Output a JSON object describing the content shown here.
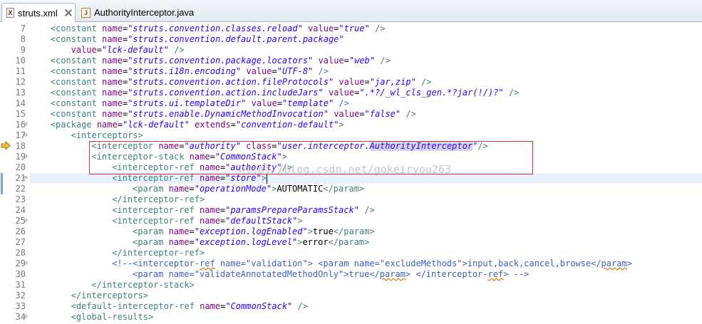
{
  "tabs": [
    {
      "label": "struts.xml",
      "icon": "xml-file-icon",
      "active": true
    },
    {
      "label": "AuthorityInterceptor.java",
      "icon": "java-file-icon",
      "active": false
    }
  ],
  "watermark": "http://blog.csdn.net/gokeiryou263",
  "lines": [
    {
      "num": "7",
      "fold": "",
      "indent": 4,
      "tokens": [
        [
          "t",
          "<constant "
        ],
        [
          "a",
          "name"
        ],
        [
          "tx",
          "="
        ],
        [
          "v",
          "\"struts.convention.classes.reload\""
        ],
        [
          "tx",
          " "
        ],
        [
          "a",
          "value"
        ],
        [
          "tx",
          "="
        ],
        [
          "v",
          "\"true\""
        ],
        [
          "t",
          " />"
        ]
      ]
    },
    {
      "num": "8",
      "fold": "",
      "indent": 4,
      "tokens": [
        [
          "t",
          "<constant "
        ],
        [
          "a",
          "name"
        ],
        [
          "tx",
          "="
        ],
        [
          "v",
          "\"struts.convention.default.parent.package\""
        ]
      ]
    },
    {
      "num": "9",
      "fold": "",
      "indent": 8,
      "tokens": [
        [
          "a",
          "value"
        ],
        [
          "tx",
          "="
        ],
        [
          "v",
          "\"lck-default\""
        ],
        [
          "t",
          " />"
        ]
      ]
    },
    {
      "num": "10",
      "fold": "",
      "indent": 4,
      "tokens": [
        [
          "t",
          "<constant "
        ],
        [
          "a",
          "name"
        ],
        [
          "tx",
          "="
        ],
        [
          "v",
          "\"struts.convention.package.locators\""
        ],
        [
          "tx",
          " "
        ],
        [
          "a",
          "value"
        ],
        [
          "tx",
          "="
        ],
        [
          "v",
          "\"web\""
        ],
        [
          "t",
          " />"
        ]
      ]
    },
    {
      "num": "11",
      "fold": "",
      "indent": 4,
      "tokens": [
        [
          "t",
          "<constant "
        ],
        [
          "a",
          "name"
        ],
        [
          "tx",
          "="
        ],
        [
          "v",
          "\"struts.i18n.encoding\""
        ],
        [
          "tx",
          " "
        ],
        [
          "a",
          "value"
        ],
        [
          "tx",
          "="
        ],
        [
          "v",
          "\"UTF-8\""
        ],
        [
          "t",
          " />"
        ]
      ]
    },
    {
      "num": "12",
      "fold": "",
      "indent": 4,
      "tokens": [
        [
          "t",
          "<constant "
        ],
        [
          "a",
          "name"
        ],
        [
          "tx",
          "="
        ],
        [
          "v",
          "\"struts.convention.action.fileProtocols\""
        ],
        [
          "tx",
          " "
        ],
        [
          "a",
          "value"
        ],
        [
          "tx",
          "="
        ],
        [
          "v",
          "\"jar,zip\""
        ],
        [
          "t",
          " />"
        ]
      ]
    },
    {
      "num": "13",
      "fold": "",
      "indent": 4,
      "tokens": [
        [
          "t",
          "<constant "
        ],
        [
          "a",
          "name"
        ],
        [
          "tx",
          "="
        ],
        [
          "v",
          "\"struts.convention.action.includeJars\""
        ],
        [
          "tx",
          " "
        ],
        [
          "a",
          "value"
        ],
        [
          "tx",
          "="
        ],
        [
          "v",
          "\".*?/_wl_cls_gen.*?jar(!/)?\""
        ],
        [
          "t",
          " />"
        ]
      ]
    },
    {
      "num": "14",
      "fold": "",
      "indent": 4,
      "tokens": [
        [
          "t",
          "<constant "
        ],
        [
          "a",
          "name"
        ],
        [
          "tx",
          "="
        ],
        [
          "v",
          "\"struts.ui.templateDir\""
        ],
        [
          "tx",
          " "
        ],
        [
          "a",
          "value"
        ],
        [
          "tx",
          "="
        ],
        [
          "v",
          "\"template\""
        ],
        [
          "t",
          " />"
        ]
      ]
    },
    {
      "num": "15",
      "fold": "",
      "indent": 4,
      "tokens": [
        [
          "t",
          "<constant "
        ],
        [
          "a",
          "name"
        ],
        [
          "tx",
          "="
        ],
        [
          "v",
          "\"struts.enable.DynamicMethodInvocation\""
        ],
        [
          "tx",
          " "
        ],
        [
          "a",
          "value"
        ],
        [
          "tx",
          "="
        ],
        [
          "v",
          "\"false\""
        ],
        [
          "t",
          " />"
        ]
      ]
    },
    {
      "num": "16",
      "fold": "⊖",
      "indent": 4,
      "tokens": [
        [
          "t",
          "<package "
        ],
        [
          "a",
          "name"
        ],
        [
          "tx",
          "="
        ],
        [
          "v",
          "\"lck-default\""
        ],
        [
          "tx",
          " "
        ],
        [
          "a",
          "extends"
        ],
        [
          "tx",
          "="
        ],
        [
          "v",
          "\"convention-default\""
        ],
        [
          "t",
          ">"
        ]
      ]
    },
    {
      "num": "17",
      "fold": "⊖",
      "indent": 8,
      "tokens": [
        [
          "t",
          "<interceptors>"
        ]
      ]
    },
    {
      "num": "18",
      "fold": "",
      "indent": 12,
      "marker": "arrow",
      "tokens": [
        [
          "t",
          "<interceptor "
        ],
        [
          "a",
          "name"
        ],
        [
          "tx",
          "="
        ],
        [
          "v",
          "\"authority\""
        ],
        [
          "tx",
          " "
        ],
        [
          "a",
          "class"
        ],
        [
          "tx",
          "="
        ],
        [
          "v",
          "\"user.interceptor."
        ],
        [
          "vh",
          "AuthorityInterceptor"
        ],
        [
          "v",
          "\""
        ],
        [
          "t",
          "/>"
        ]
      ]
    },
    {
      "num": "19",
      "fold": "⊖",
      "indent": 12,
      "tokens": [
        [
          "t",
          "<interceptor-stack "
        ],
        [
          "a",
          "name"
        ],
        [
          "tx",
          "="
        ],
        [
          "v",
          "\"CommonStack\""
        ],
        [
          "t",
          ">"
        ]
      ]
    },
    {
      "num": "20",
      "fold": "",
      "indent": 16,
      "tokens": [
        [
          "t",
          "<interceptor-ref "
        ],
        [
          "a",
          "name"
        ],
        [
          "tx",
          "="
        ],
        [
          "v",
          "\"authority\""
        ],
        [
          "t",
          "/>"
        ]
      ]
    },
    {
      "num": "21",
      "fold": "⊖",
      "indent": 16,
      "marker": "bar",
      "current": true,
      "tokens": [
        [
          "t",
          "<interceptor-ref "
        ],
        [
          "a",
          "name"
        ],
        [
          "tx",
          "="
        ],
        [
          "v",
          "\"store\""
        ],
        [
          "t",
          ">"
        ]
      ]
    },
    {
      "num": "22",
      "fold": "",
      "indent": 20,
      "marker": "bar",
      "tokens": [
        [
          "t",
          "<param "
        ],
        [
          "a",
          "name"
        ],
        [
          "tx",
          "="
        ],
        [
          "v",
          "\"operationMode\""
        ],
        [
          "t",
          ">"
        ],
        [
          "tx",
          "AUTOMATIC"
        ],
        [
          "t",
          "</param>"
        ]
      ]
    },
    {
      "num": "23",
      "fold": "",
      "indent": 16,
      "tokens": [
        [
          "t",
          "</interceptor-ref>"
        ]
      ]
    },
    {
      "num": "24",
      "fold": "",
      "indent": 16,
      "tokens": [
        [
          "t",
          "<interceptor-ref "
        ],
        [
          "a",
          "name"
        ],
        [
          "tx",
          "="
        ],
        [
          "v",
          "\"paramsPrepareParamsStack\""
        ],
        [
          "t",
          " />"
        ]
      ]
    },
    {
      "num": "25",
      "fold": "⊖",
      "indent": 16,
      "tokens": [
        [
          "t",
          "<interceptor-ref "
        ],
        [
          "a",
          "name"
        ],
        [
          "tx",
          "="
        ],
        [
          "v",
          "\"defaultStack\""
        ],
        [
          "t",
          ">"
        ]
      ]
    },
    {
      "num": "26",
      "fold": "",
      "indent": 20,
      "tokens": [
        [
          "t",
          "<param "
        ],
        [
          "a",
          "name"
        ],
        [
          "tx",
          "="
        ],
        [
          "v",
          "\"exception.logEnabled\""
        ],
        [
          "t",
          ">"
        ],
        [
          "tx",
          "true"
        ],
        [
          "t",
          "</param>"
        ]
      ]
    },
    {
      "num": "27",
      "fold": "",
      "indent": 20,
      "tokens": [
        [
          "t",
          "<param "
        ],
        [
          "a",
          "name"
        ],
        [
          "tx",
          "="
        ],
        [
          "v",
          "\"exception.logLevel\""
        ],
        [
          "t",
          ">"
        ],
        [
          "tx",
          "error"
        ],
        [
          "t",
          "</param>"
        ]
      ]
    },
    {
      "num": "28",
      "fold": "",
      "indent": 16,
      "tokens": [
        [
          "t",
          "</interceptor-ref>"
        ]
      ]
    },
    {
      "num": "29",
      "fold": "⊖",
      "indent": 16,
      "tokens": [
        [
          "cm",
          "<!--<interceptor-"
        ],
        [
          "cms",
          "ref"
        ],
        [
          "cm",
          " name=\"validation\"> <param name=\"excludeMethods\">input,back,cancel,browse</"
        ],
        [
          "cms",
          "param"
        ],
        [
          "cm",
          ">"
        ]
      ]
    },
    {
      "num": "30",
      "fold": "",
      "indent": 20,
      "tokens": [
        [
          "cm",
          "<param name=\"validateAnnotatedMethodOnly\">true</"
        ],
        [
          "cms",
          "param"
        ],
        [
          "cm",
          "> </interceptor-"
        ],
        [
          "cms",
          "ref"
        ],
        [
          "cm",
          "> -->"
        ]
      ]
    },
    {
      "num": "31",
      "fold": "",
      "indent": 12,
      "tokens": [
        [
          "t",
          "</interceptor-stack>"
        ]
      ]
    },
    {
      "num": "32",
      "fold": "",
      "indent": 8,
      "tokens": [
        [
          "t",
          "</interceptors>"
        ]
      ]
    },
    {
      "num": "33",
      "fold": "",
      "indent": 8,
      "tokens": [
        [
          "t",
          "<default-interceptor-ref "
        ],
        [
          "a",
          "name"
        ],
        [
          "tx",
          "="
        ],
        [
          "v",
          "\"CommonStack\""
        ],
        [
          "t",
          " />"
        ]
      ]
    },
    {
      "num": "34",
      "fold": "⊖",
      "indent": 8,
      "tokens": [
        [
          "t",
          "<global-results>"
        ]
      ]
    }
  ]
}
